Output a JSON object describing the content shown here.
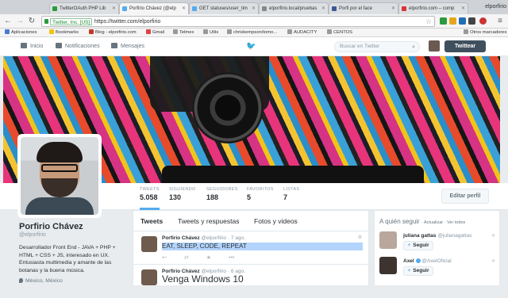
{
  "browser": {
    "tabs": [
      {
        "title": "TwitterOAuth PHP Lib",
        "color": "#2a9a3f",
        "active": false
      },
      {
        "title": "Porfirio Chávez (@elp",
        "color": "#55acee",
        "active": true
      },
      {
        "title": "GET statuses/user_tim",
        "color": "#55acee",
        "active": false
      },
      {
        "title": "elporfirio.local/pruebas",
        "color": "#888888",
        "active": false
      },
      {
        "title": "Porfi por el face",
        "color": "#3b5998",
        "active": false
      },
      {
        "title": "elporfirio.com – comp",
        "color": "#d33",
        "active": false
      }
    ],
    "profile_name": "elporfirio",
    "secure_label": "Twitter, Inc. [US]",
    "url": "https://twitter.com/elporfirio",
    "bookmarks": [
      "Aplicaciones",
      "Bookmarks",
      "Blog - elporfirio.com",
      "Gmail",
      "Telmex",
      "Utils",
      "chriskempson/tomo...",
      "AUDACITY",
      "CENTOS"
    ],
    "other_bookmarks": "Otros marcadores"
  },
  "twitter_nav": {
    "home": "Inicio",
    "notifications": "Notificaciones",
    "messages": "Mensajes",
    "search_placeholder": "Buscar en Twitter",
    "tweet_button": "Twittear"
  },
  "stats": [
    {
      "label": "TWEETS",
      "value": "5.058"
    },
    {
      "label": "SIGUIENDO",
      "value": "130"
    },
    {
      "label": "SEGUIDORES",
      "value": "188"
    },
    {
      "label": "FAVORITOS",
      "value": "5"
    },
    {
      "label": "LISTAS",
      "value": "7"
    }
  ],
  "edit_profile": "Editar perfil",
  "profile": {
    "name": "Porfirio Chávez",
    "handle": "@elporfirio",
    "bio": "Desarrollador Front End - JAVA + PHP + HTML + CSS + JS, interesado en UX. Entusiasta multimedia y amante de las botanas y la buena música.",
    "location": "México, México"
  },
  "timeline": {
    "tabs": [
      "Tweets",
      "Tweets y respuestas",
      "Fotos y videos"
    ],
    "tweets": [
      {
        "name": "Porfirio Chávez",
        "handle": "@elporfirio",
        "time": "· 7 ago.",
        "text": "EAT, SLEEP, CODE, REPEAT"
      },
      {
        "name": "Porfirio Chávez",
        "handle": "@elporfirio",
        "time": "· 6 ago.",
        "text": "Venga Windows 10"
      }
    ]
  },
  "who_to_follow": {
    "title": "A quién seguir",
    "links": "· Actualizar · Ver todos",
    "follow_label": "Seguir",
    "suggestions": [
      {
        "name": "juliana gattas",
        "handle": "@julianagattas"
      },
      {
        "name": "Axel",
        "handle": "@AxelOficial"
      }
    ]
  }
}
